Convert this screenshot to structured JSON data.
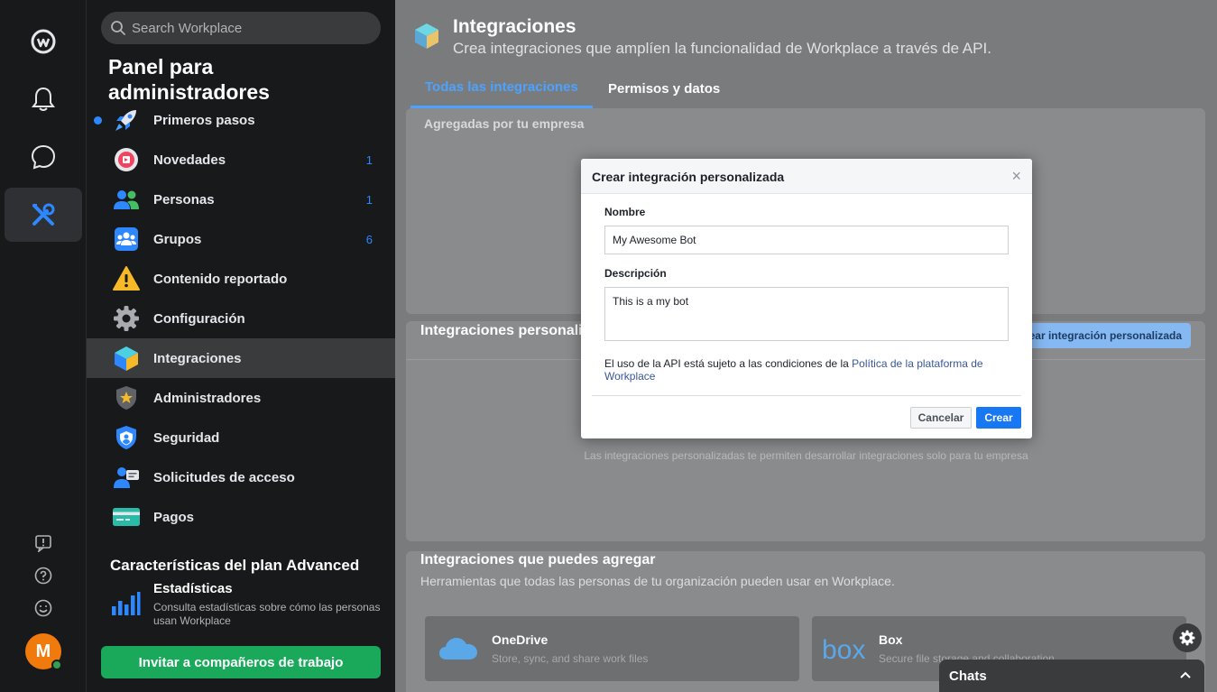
{
  "search": {
    "placeholder": "Search Workplace"
  },
  "sidebar": {
    "title": "Panel para administradores",
    "items": [
      {
        "label": "Primeros pasos",
        "count": "",
        "icon": "rocket-icon"
      },
      {
        "label": "Novedades",
        "count": "1",
        "icon": "news-icon"
      },
      {
        "label": "Personas",
        "count": "1",
        "icon": "people-icon"
      },
      {
        "label": "Grupos",
        "count": "6",
        "icon": "groups-icon"
      },
      {
        "label": "Contenido reportado",
        "count": "",
        "icon": "warning-icon"
      },
      {
        "label": "Configuración",
        "count": "",
        "icon": "gear-icon"
      },
      {
        "label": "Integraciones",
        "count": "",
        "icon": "cube-icon"
      },
      {
        "label": "Administradores",
        "count": "",
        "icon": "admin-shield-icon"
      },
      {
        "label": "Seguridad",
        "count": "",
        "icon": "security-shield-icon"
      },
      {
        "label": "Solicitudes de acceso",
        "count": "",
        "icon": "access-request-icon"
      },
      {
        "label": "Pagos",
        "count": "",
        "icon": "card-icon"
      }
    ],
    "plan_title": "Características del plan Advanced",
    "stats_title": "Estadísticas",
    "stats_desc": "Consulta estadísticas sobre cómo las personas usan Workplace",
    "invite_label": "Invitar a compañeros de trabajo"
  },
  "rail": {
    "avatar_letter": "M"
  },
  "main": {
    "title": "Integraciones",
    "subtitle": "Crea integraciones que amplíen la funcionalidad de Workplace a través de API.",
    "tabs": [
      "Todas las integraciones",
      "Permisos y datos"
    ],
    "added_by_company": "Agregadas por tu empresa",
    "custom_title": "Integraciones personalizadas",
    "create_custom_btn": "Crear integración personalizada",
    "custom_note": "Las integraciones personalizadas te permiten desarrollar integraciones solo para tu empresa",
    "available_title": "Integraciones que puedes agregar",
    "available_sub": "Herramientas que todas las personas de tu organización pueden usar en Workplace.",
    "apps": [
      {
        "name": "OneDrive",
        "desc": "Store, sync, and share work files"
      },
      {
        "name": "Box",
        "desc": "Secure file storage and collaboration"
      }
    ],
    "chats_label": "Chats"
  },
  "modal": {
    "title": "Crear integración personalizada",
    "name_label": "Nombre",
    "name_value": "My Awesome Bot",
    "desc_label": "Descripción",
    "desc_value": "This is a my bot",
    "terms_prefix": "El uso de la API está sujeto a las condiciones de la ",
    "terms_link": "Política de la plataforma de Workplace",
    "cancel_label": "Cancelar",
    "create_label": "Crear"
  },
  "colors": {
    "accent": "#2d88ff",
    "invite": "#1aa95a",
    "avatar": "#f07a0c",
    "create": "#1877f2"
  }
}
